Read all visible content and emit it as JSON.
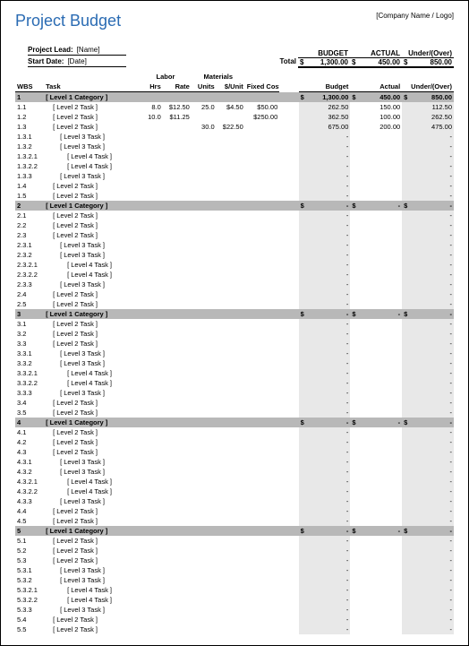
{
  "title": "Project Budget",
  "company_logo": "[Company Name / Logo]",
  "meta": {
    "lead_label": "Project Lead:",
    "lead_value": "[Name]",
    "start_label": "Start Date:",
    "start_value": "[Date]"
  },
  "totals": {
    "total_label": "Total",
    "budget_label": "BUDGET",
    "actual_label": "ACTUAL",
    "uo_label": "Under/(Over)",
    "budget": "1,300.00",
    "actual": "450.00",
    "uo": "850.00"
  },
  "cols": {
    "wbs": "WBS",
    "task": "Task",
    "labor": "Labor",
    "hrs": "Hrs",
    "rate": "Rate",
    "materials": "Materials",
    "units": "Units",
    "perunit": "$/Unit",
    "fixed": "Fixed Costs",
    "budget": "Budget",
    "actual": "Actual",
    "uo": "Under/(Over)"
  },
  "rows": [
    {
      "t": "cat",
      "wbs": "1",
      "task": "[ Level 1 Category ]",
      "b": "1,300.00",
      "a": "450.00",
      "u": "850.00",
      "d": true
    },
    {
      "t": "r",
      "wbs": "1.1",
      "task": "[ Level 2 Task ]",
      "i": 1,
      "hrs": "8.0",
      "rate": "$12.50",
      "un": "25.0",
      "pu": "$4.50",
      "fx": "$50.00",
      "b": "262.50",
      "a": "150.00",
      "u": "112.50"
    },
    {
      "t": "r",
      "wbs": "1.2",
      "task": "[ Level 2 Task ]",
      "i": 1,
      "hrs": "10.0",
      "rate": "$11.25",
      "fx": "$250.00",
      "b": "362.50",
      "a": "100.00",
      "u": "262.50"
    },
    {
      "t": "r",
      "wbs": "1.3",
      "task": "[ Level 2 Task ]",
      "i": 1,
      "un": "30.0",
      "pu": "$22.50",
      "b": "675.00",
      "a": "200.00",
      "u": "475.00"
    },
    {
      "t": "r",
      "wbs": "1.3.1",
      "task": "[ Level 3 Task ]",
      "i": 2,
      "b": "-",
      "a": "",
      "u": "-"
    },
    {
      "t": "r",
      "wbs": "1.3.2",
      "task": "[ Level 3 Task ]",
      "i": 2,
      "b": "-",
      "a": "",
      "u": "-"
    },
    {
      "t": "r",
      "wbs": "1.3.2.1",
      "task": "[ Level 4 Task ]",
      "i": 3,
      "b": "-",
      "a": "",
      "u": "-"
    },
    {
      "t": "r",
      "wbs": "1.3.2.2",
      "task": "[ Level 4 Task ]",
      "i": 3,
      "b": "-",
      "a": "",
      "u": "-"
    },
    {
      "t": "r",
      "wbs": "1.3.3",
      "task": "[ Level 3 Task ]",
      "i": 2,
      "b": "-",
      "a": "",
      "u": "-"
    },
    {
      "t": "r",
      "wbs": "1.4",
      "task": "[ Level 2 Task ]",
      "i": 1,
      "b": "-",
      "a": "",
      "u": "-"
    },
    {
      "t": "r",
      "wbs": "1.5",
      "task": "[ Level 2 Task ]",
      "i": 1,
      "b": "-",
      "a": "",
      "u": "-"
    },
    {
      "t": "cat",
      "wbs": "2",
      "task": "[ Level 1 Category ]",
      "b": "-",
      "a": "-",
      "u": "-",
      "d": true
    },
    {
      "t": "r",
      "wbs": "2.1",
      "task": "[ Level 2 Task ]",
      "i": 1,
      "b": "-",
      "a": "",
      "u": "-"
    },
    {
      "t": "r",
      "wbs": "2.2",
      "task": "[ Level 2 Task ]",
      "i": 1,
      "b": "-",
      "a": "",
      "u": "-"
    },
    {
      "t": "r",
      "wbs": "2.3",
      "task": "[ Level 2 Task ]",
      "i": 1,
      "b": "-",
      "a": "",
      "u": "-"
    },
    {
      "t": "r",
      "wbs": "2.3.1",
      "task": "[ Level 3 Task ]",
      "i": 2,
      "b": "-",
      "a": "",
      "u": "-"
    },
    {
      "t": "r",
      "wbs": "2.3.2",
      "task": "[ Level 3 Task ]",
      "i": 2,
      "b": "-",
      "a": "",
      "u": "-"
    },
    {
      "t": "r",
      "wbs": "2.3.2.1",
      "task": "[ Level 4 Task ]",
      "i": 3,
      "b": "-",
      "a": "",
      "u": "-"
    },
    {
      "t": "r",
      "wbs": "2.3.2.2",
      "task": "[ Level 4 Task ]",
      "i": 3,
      "b": "-",
      "a": "",
      "u": "-"
    },
    {
      "t": "r",
      "wbs": "2.3.3",
      "task": "[ Level 3 Task ]",
      "i": 2,
      "b": "-",
      "a": "",
      "u": "-"
    },
    {
      "t": "r",
      "wbs": "2.4",
      "task": "[ Level 2 Task ]",
      "i": 1,
      "b": "-",
      "a": "",
      "u": "-"
    },
    {
      "t": "r",
      "wbs": "2.5",
      "task": "[ Level 2 Task ]",
      "i": 1,
      "b": "-",
      "a": "",
      "u": "-"
    },
    {
      "t": "cat",
      "wbs": "3",
      "task": "[ Level 1 Category ]",
      "b": "-",
      "a": "-",
      "u": "-",
      "d": true
    },
    {
      "t": "r",
      "wbs": "3.1",
      "task": "[ Level 2 Task ]",
      "i": 1,
      "b": "-",
      "a": "",
      "u": "-"
    },
    {
      "t": "r",
      "wbs": "3.2",
      "task": "[ Level 2 Task ]",
      "i": 1,
      "b": "-",
      "a": "",
      "u": "-"
    },
    {
      "t": "r",
      "wbs": "3.3",
      "task": "[ Level 2 Task ]",
      "i": 1,
      "b": "-",
      "a": "",
      "u": "-"
    },
    {
      "t": "r",
      "wbs": "3.3.1",
      "task": "[ Level 3 Task ]",
      "i": 2,
      "b": "-",
      "a": "",
      "u": "-"
    },
    {
      "t": "r",
      "wbs": "3.3.2",
      "task": "[ Level 3 Task ]",
      "i": 2,
      "b": "-",
      "a": "",
      "u": "-"
    },
    {
      "t": "r",
      "wbs": "3.3.2.1",
      "task": "[ Level 4 Task ]",
      "i": 3,
      "b": "-",
      "a": "",
      "u": "-"
    },
    {
      "t": "r",
      "wbs": "3.3.2.2",
      "task": "[ Level 4 Task ]",
      "i": 3,
      "b": "-",
      "a": "",
      "u": "-"
    },
    {
      "t": "r",
      "wbs": "3.3.3",
      "task": "[ Level 3 Task ]",
      "i": 2,
      "b": "-",
      "a": "",
      "u": "-"
    },
    {
      "t": "r",
      "wbs": "3.4",
      "task": "[ Level 2 Task ]",
      "i": 1,
      "b": "-",
      "a": "",
      "u": "-"
    },
    {
      "t": "r",
      "wbs": "3.5",
      "task": "[ Level 2 Task ]",
      "i": 1,
      "b": "-",
      "a": "",
      "u": "-"
    },
    {
      "t": "cat",
      "wbs": "4",
      "task": "[ Level 1 Category ]",
      "b": "-",
      "a": "-",
      "u": "-",
      "d": true
    },
    {
      "t": "r",
      "wbs": "4.1",
      "task": "[ Level 2 Task ]",
      "i": 1,
      "b": "-",
      "a": "",
      "u": "-"
    },
    {
      "t": "r",
      "wbs": "4.2",
      "task": "[ Level 2 Task ]",
      "i": 1,
      "b": "-",
      "a": "",
      "u": "-"
    },
    {
      "t": "r",
      "wbs": "4.3",
      "task": "[ Level 2 Task ]",
      "i": 1,
      "b": "-",
      "a": "",
      "u": "-"
    },
    {
      "t": "r",
      "wbs": "4.3.1",
      "task": "[ Level 3 Task ]",
      "i": 2,
      "b": "-",
      "a": "",
      "u": "-"
    },
    {
      "t": "r",
      "wbs": "4.3.2",
      "task": "[ Level 3 Task ]",
      "i": 2,
      "b": "-",
      "a": "",
      "u": "-"
    },
    {
      "t": "r",
      "wbs": "4.3.2.1",
      "task": "[ Level 4 Task ]",
      "i": 3,
      "b": "-",
      "a": "",
      "u": "-"
    },
    {
      "t": "r",
      "wbs": "4.3.2.2",
      "task": "[ Level 4 Task ]",
      "i": 3,
      "b": "-",
      "a": "",
      "u": "-"
    },
    {
      "t": "r",
      "wbs": "4.3.3",
      "task": "[ Level 3 Task ]",
      "i": 2,
      "b": "-",
      "a": "",
      "u": "-"
    },
    {
      "t": "r",
      "wbs": "4.4",
      "task": "[ Level 2 Task ]",
      "i": 1,
      "b": "-",
      "a": "",
      "u": "-"
    },
    {
      "t": "r",
      "wbs": "4.5",
      "task": "[ Level 2 Task ]",
      "i": 1,
      "b": "-",
      "a": "",
      "u": "-"
    },
    {
      "t": "cat",
      "wbs": "5",
      "task": "[ Level 1 Category ]",
      "b": "-",
      "a": "-",
      "u": "-",
      "d": true
    },
    {
      "t": "r",
      "wbs": "5.1",
      "task": "[ Level 2 Task ]",
      "i": 1,
      "b": "-",
      "a": "",
      "u": "-"
    },
    {
      "t": "r",
      "wbs": "5.2",
      "task": "[ Level 2 Task ]",
      "i": 1,
      "b": "-",
      "a": "",
      "u": "-"
    },
    {
      "t": "r",
      "wbs": "5.3",
      "task": "[ Level 2 Task ]",
      "i": 1,
      "b": "-",
      "a": "",
      "u": "-"
    },
    {
      "t": "r",
      "wbs": "5.3.1",
      "task": "[ Level 3 Task ]",
      "i": 2,
      "b": "-",
      "a": "",
      "u": "-"
    },
    {
      "t": "r",
      "wbs": "5.3.2",
      "task": "[ Level 3 Task ]",
      "i": 2,
      "b": "-",
      "a": "",
      "u": "-"
    },
    {
      "t": "r",
      "wbs": "5.3.2.1",
      "task": "[ Level 4 Task ]",
      "i": 3,
      "b": "-",
      "a": "",
      "u": "-"
    },
    {
      "t": "r",
      "wbs": "5.3.2.2",
      "task": "[ Level 4 Task ]",
      "i": 3,
      "b": "-",
      "a": "",
      "u": "-"
    },
    {
      "t": "r",
      "wbs": "5.3.3",
      "task": "[ Level 3 Task ]",
      "i": 2,
      "b": "-",
      "a": "",
      "u": "-"
    },
    {
      "t": "r",
      "wbs": "5.4",
      "task": "[ Level 2 Task ]",
      "i": 1,
      "b": "-",
      "a": "",
      "u": "-"
    },
    {
      "t": "r",
      "wbs": "5.5",
      "task": "[ Level 2 Task ]",
      "i": 1,
      "b": "-",
      "a": "",
      "u": "-"
    }
  ]
}
